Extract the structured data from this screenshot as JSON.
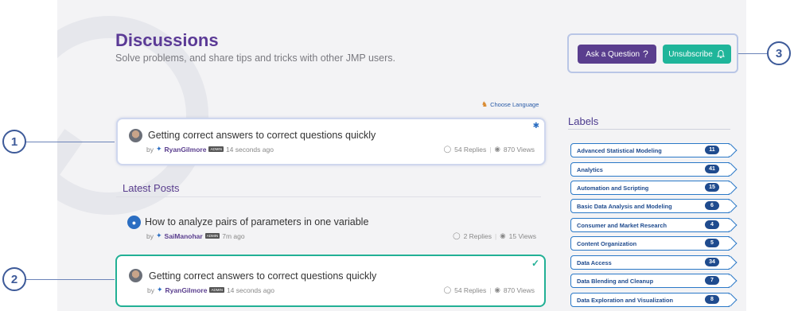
{
  "header": {
    "title": "Discussions",
    "subtitle": "Solve problems, and share tips and tricks with other JMP users."
  },
  "actions": {
    "ask_label": "Ask a Question",
    "ask_icon": "question-mark",
    "unsubscribe_label": "Unsubscribe",
    "unsubscribe_icon": "bell"
  },
  "language_link": "Choose Language",
  "featured_post": {
    "title": "Getting correct answers to correct questions quickly",
    "by": "by",
    "author": "RyanGilmore",
    "rank": "ADMIN",
    "time": "14 seconds ago",
    "replies": "54 Replies",
    "views": "870 Views",
    "pinned": true
  },
  "latest": {
    "heading": "Latest Posts",
    "posts": [
      {
        "title": "How to analyze pairs of parameters in one variable",
        "by": "by",
        "author": "SaiManohar",
        "rank": "ADMIN",
        "time": "7m ago",
        "replies": "2 Replies",
        "views": "15 Views"
      },
      {
        "title": "Getting correct answers to correct questions quickly",
        "by": "by",
        "author": "RyanGilmore",
        "rank": "ADMIN",
        "time": "14 seconds ago",
        "replies": "54 Replies",
        "views": "870 Views",
        "selected": true
      }
    ]
  },
  "labels": {
    "heading": "Labels",
    "items": [
      {
        "name": "Advanced Statistical Modeling",
        "count": "11"
      },
      {
        "name": "Analytics",
        "count": "41"
      },
      {
        "name": "Automation and Scripting",
        "count": "15"
      },
      {
        "name": "Basic Data Analysis and Modeling",
        "count": "6"
      },
      {
        "name": "Consumer and Market Research",
        "count": "4"
      },
      {
        "name": "Content Organization",
        "count": "5"
      },
      {
        "name": "Data Access",
        "count": "34"
      },
      {
        "name": "Data Blending and Cleanup",
        "count": "7"
      },
      {
        "name": "Data Exploration and Visualization",
        "count": "8"
      }
    ]
  },
  "callouts": [
    "1",
    "2",
    "3"
  ],
  "colors": {
    "brand_purple": "#5a3e8e",
    "accent_teal": "#1fb59a",
    "label_blue": "#1f4b8e",
    "callout_blue": "#3d5a99"
  }
}
